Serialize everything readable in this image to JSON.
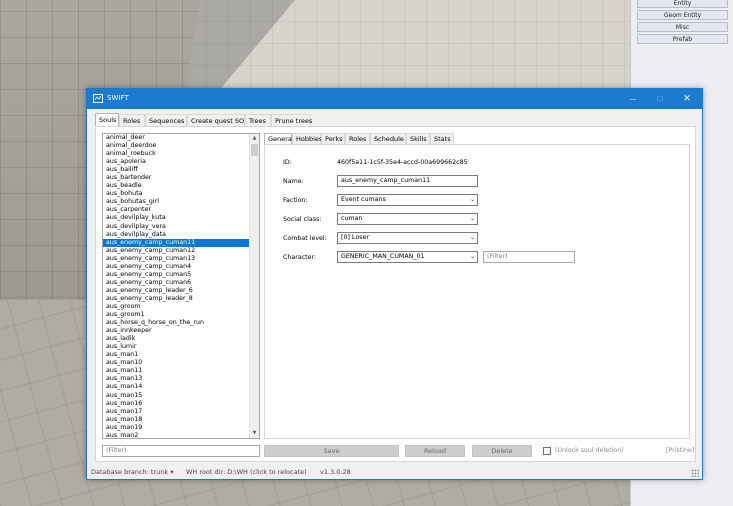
{
  "editor_panel": {
    "buttons": [
      "Entity",
      "Geom Entity",
      "Misc",
      "Prefab"
    ]
  },
  "window": {
    "title": "SWIFT",
    "controls": {
      "minimize": "—",
      "maximize": "☐",
      "close": "✕"
    },
    "main_tabs": [
      "Souls",
      "Roles",
      "Sequences",
      "Create quest SO",
      "Trees",
      "Prune trees"
    ],
    "active_main_tab": "Souls"
  },
  "soul_list": {
    "items": [
      "animal_deer",
      "animal_deerdoe",
      "animal_roebuck",
      "aus_apoleria",
      "aus_bailiff",
      "aus_bartender",
      "aus_beadle",
      "aus_bohuta",
      "aus_bohutas_girl",
      "aus_carpenter",
      "aus_devilplay_kuta",
      "aus_devilplay_vera",
      "aus_devilplay_data",
      "aus_enemy_camp_cuman11",
      "aus_enemy_camp_cuman12",
      "aus_enemy_camp_cuman13",
      "aus_enemy_camp_cuman4",
      "aus_enemy_camp_cuman5",
      "aus_enemy_camp_cuman6",
      "aus_enemy_camp_leader_6",
      "aus_enemy_camp_leader_8",
      "aus_groom",
      "aus_groom1",
      "aus_horse_q_horse_on_the_run",
      "aus_innkeeper",
      "aus_ladik",
      "aus_lumir",
      "aus_man1",
      "aus_man10",
      "aus_man11",
      "aus_man13",
      "aus_man14",
      "aus_man15",
      "aus_man16",
      "aus_man17",
      "aus_man18",
      "aus_man19",
      "aus_man2"
    ],
    "selected": "aus_enemy_camp_cuman11",
    "filter_placeholder": "(Filter)"
  },
  "detail": {
    "tabs": [
      "General",
      "Hobbies",
      "Perks",
      "Roles",
      "Schedule",
      "Skills",
      "Stats"
    ],
    "active_tab": "General",
    "id_label": "ID:",
    "id_value": "460f5a11-1c5f-35e4-accd-00a699662c85",
    "name_label": "Name:",
    "name_value": "aus_enemy_camp_cuman11",
    "faction_label": "Faction:",
    "faction_value": "Event cumans",
    "social_label": "Social class:",
    "social_value": "cuman",
    "combat_label": "Combat level:",
    "combat_value": "[0] Loser",
    "character_label": "Character:",
    "character_value": "GENERIC_MAN_CUMAN_01",
    "character_filter_placeholder": "(Filter)"
  },
  "actions": {
    "save": "Save",
    "reload": "Reload",
    "delete": "Delete",
    "unlock_label": "(Unlock soul deletion)",
    "state": "[Pristine]"
  },
  "status": {
    "branch": "Database branch: trunk ▾",
    "root": "WH root dir: D:\\WH (click to relocate)",
    "version": "v1.3.0.28"
  }
}
